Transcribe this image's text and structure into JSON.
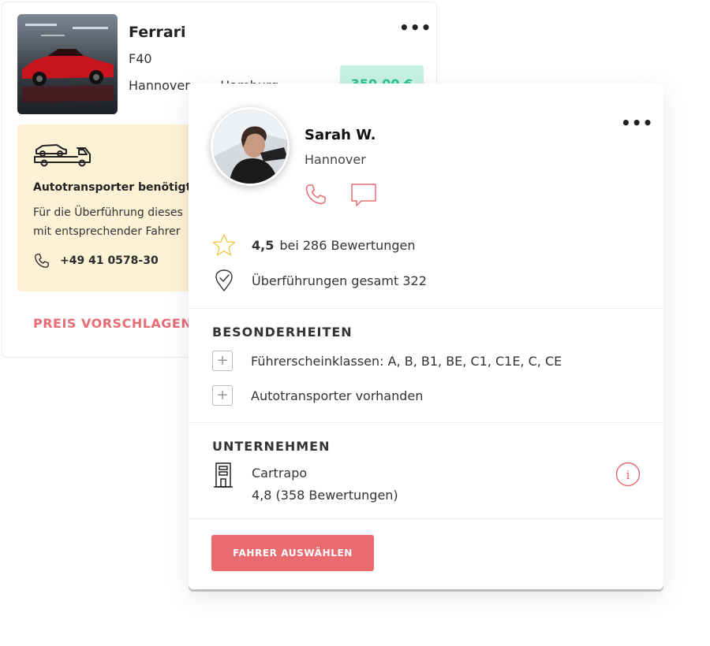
{
  "order": {
    "car_title": "Ferrari",
    "car_model": "F40",
    "route_from": "Hannover",
    "route_to": "Hamburg",
    "route_arrow": "›",
    "price": "350,00 €",
    "more": "•••",
    "transport_title": "Autotransporter benötigt",
    "transport_desc_line1": "Für die Überführung dieses",
    "transport_desc_line2": "mit entsprechender Fahrer",
    "phone": "+49 41 0578-30",
    "propose_label": "PREIS VORSCHLAGEN"
  },
  "driver": {
    "name": "Sarah W.",
    "city": "Hannover",
    "more": "•••",
    "rating_value": "4,5",
    "rating_text": "bei 286 Bewertungen",
    "transfers_text": "Überführungen gesamt 322"
  },
  "features": {
    "title": "BESONDERHEITEN",
    "items": [
      {
        "label": "Führerscheinklassen: A, B, B1, BE, C1, C1E, C, CE",
        "icon": "+"
      },
      {
        "label": "Autotransporter vorhanden",
        "icon": "+"
      }
    ]
  },
  "company": {
    "title": "UNTERNEHMEN",
    "name": "Cartrapo",
    "rating": "4,8 (358 Bewertungen)",
    "info_icon": "i"
  },
  "actions": {
    "select_label": "FAHRER AUSWÄHLEN"
  },
  "colors": {
    "accent": "#e96a6f",
    "price_bg": "#c7f2e3",
    "price_text": "#2bc58b",
    "notice_bg": "#fdf1d6"
  }
}
